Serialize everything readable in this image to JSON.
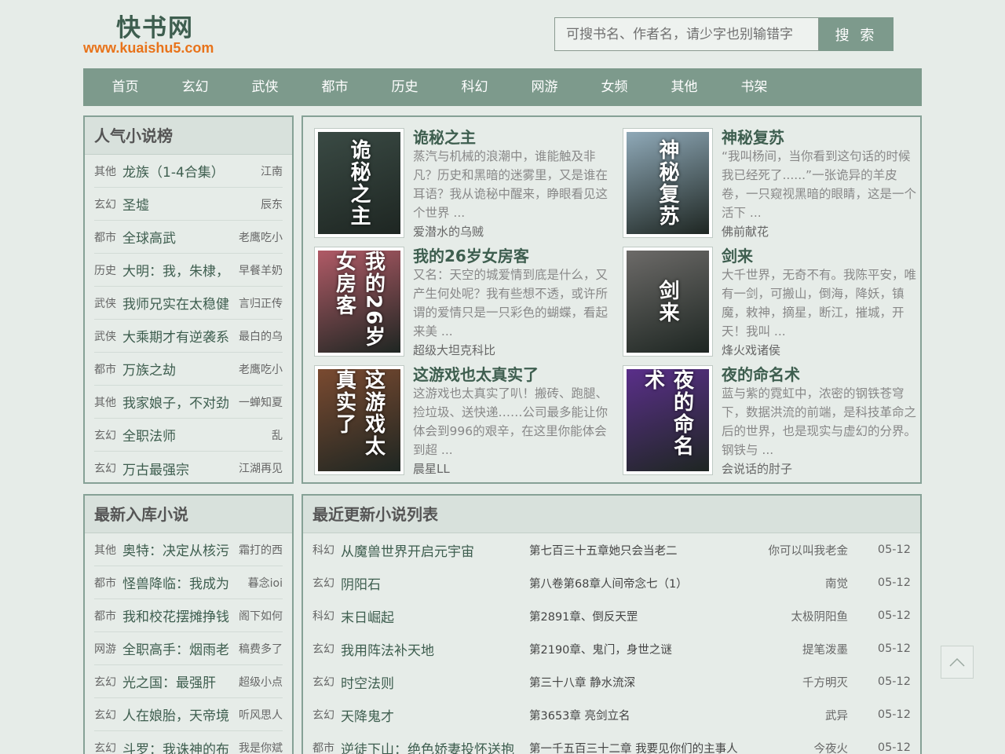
{
  "site": {
    "title": "快书网",
    "url": "www.kuaishu5.com"
  },
  "search": {
    "placeholder": "可搜书名、作者名，请少字也别输错字",
    "button": "搜 索"
  },
  "nav": [
    "首页",
    "玄幻",
    "武侠",
    "都市",
    "历史",
    "科幻",
    "网游",
    "女频",
    "其他",
    "书架"
  ],
  "popular": {
    "title": "人气小说榜",
    "items": [
      {
        "cat": "其他",
        "name": "龙族（1-4合集）",
        "author": "江南"
      },
      {
        "cat": "玄幻",
        "name": "圣墟",
        "author": "辰东"
      },
      {
        "cat": "都市",
        "name": "全球高武",
        "author": "老鹰吃小"
      },
      {
        "cat": "历史",
        "name": "大明：我，朱棣，",
        "author": "早餐羊奶"
      },
      {
        "cat": "武侠",
        "name": "我师兄实在太稳健",
        "author": "言归正传"
      },
      {
        "cat": "武侠",
        "name": "大乘期才有逆袭系",
        "author": "最白的乌"
      },
      {
        "cat": "都市",
        "name": "万族之劫",
        "author": "老鹰吃小"
      },
      {
        "cat": "其他",
        "name": "我家娘子，不对劲",
        "author": "一蝉知夏"
      },
      {
        "cat": "玄幻",
        "name": "全职法师",
        "author": "乱"
      },
      {
        "cat": "玄幻",
        "name": "万古最强宗",
        "author": "江湖再见"
      }
    ]
  },
  "featured": [
    {
      "title": "诡秘之主",
      "desc": "蒸汽与机械的浪潮中，谁能触及非凡？历史和黑暗的迷雾里，又是谁在耳语？我从诡秘中醒来，睁眼看见这个世界 ...",
      "author": "爱潜水的乌贼",
      "cover": "诡秘之主",
      "color": "#3a4a44"
    },
    {
      "title": "神秘复苏",
      "desc": "“我叫杨间，当你看到这句话的时候我已经死了......”一张诡异的羊皮卷，一只窥视黑暗的眼睛，这是一个活下 ...",
      "author": "佛前献花",
      "cover": "神秘复苏",
      "color": "#8fa9b8"
    },
    {
      "title": "我的26岁女房客",
      "desc": "又名：天空的城爱情到底是什么，又产生何处呢？我有些想不透，或许所谓的爱情只是一只彩色的蝴蝶，看起来美 ...",
      "author": "超级大坦克科比",
      "cover": "我的26岁女房客",
      "color": "#b05a66"
    },
    {
      "title": "剑来",
      "desc": "大千世界，无奇不有。我陈平安，唯有一剑，可搬山，倒海，降妖，镇魔，敕神，摘星，断江，摧城，开天！我叫 ...",
      "author": "烽火戏诸侯",
      "cover": "剑来",
      "color": "#6c6a68"
    },
    {
      "title": "这游戏也太真实了",
      "desc": "这游戏也太真实了叭！搬砖、跑腿、捡垃圾、送快递……公司最多能让你体会到996的艰辛，在这里你能体会到超 ...",
      "author": "晨星LL",
      "cover": "这游戏太真实了",
      "color": "#7a4a30"
    },
    {
      "title": "夜的命名术",
      "desc": "蓝与紫的霓虹中，浓密的钢铁苍穹下，数据洪流的前端，是科技革命之后的世界，也是现实与虚幻的分界。钢铁与 ...",
      "author": "会说话的肘子",
      "cover": "夜的命名术",
      "color": "#5a2f8a"
    }
  ],
  "latest": {
    "title": "最新入库小说",
    "items": [
      {
        "cat": "其他",
        "name": "奥特：决定从核污",
        "author": "霜打的西"
      },
      {
        "cat": "都市",
        "name": "怪兽降临：我成为",
        "author": "暮念ioi"
      },
      {
        "cat": "都市",
        "name": "我和校花摆摊挣钱",
        "author": "阁下如何"
      },
      {
        "cat": "网游",
        "name": "全职高手：烟雨老",
        "author": "稿费多了"
      },
      {
        "cat": "玄幻",
        "name": "光之国：最强肝",
        "author": "超级小点"
      },
      {
        "cat": "玄幻",
        "name": "人在娘胎，天帝境",
        "author": "听风思人"
      },
      {
        "cat": "玄幻",
        "name": "斗罗：我诛神的布",
        "author": "我是你斌"
      }
    ]
  },
  "updates": {
    "title": "最近更新小说列表",
    "items": [
      {
        "cat": "科幻",
        "name": "从魔兽世界开启元宇宙",
        "chapter": "第七百三十五章她只会当老二",
        "author": "你可以叫我老金",
        "date": "05-12"
      },
      {
        "cat": "玄幻",
        "name": "阴阳石",
        "chapter": "第八卷第68章人间帝念七（1）",
        "author": "南觉",
        "date": "05-12"
      },
      {
        "cat": "科幻",
        "name": "末日崛起",
        "chapter": "第2891章、倒反天罡",
        "author": "太极阴阳鱼",
        "date": "05-12"
      },
      {
        "cat": "玄幻",
        "name": "我用阵法补天地",
        "chapter": "第2190章、鬼门，身世之谜",
        "author": "提笔泼墨",
        "date": "05-12"
      },
      {
        "cat": "玄幻",
        "name": "时空法则",
        "chapter": "第三十八章 静水流深",
        "author": "千方明灭",
        "date": "05-12"
      },
      {
        "cat": "玄幻",
        "name": "天降鬼才",
        "chapter": "第3653章 亮剑立名",
        "author": "武异",
        "date": "05-12"
      },
      {
        "cat": "都市",
        "name": "逆徒下山：绝色娇妻投怀送抱",
        "chapter": "第一千五百三十二章 我要见你们的主事人",
        "author": "今夜火",
        "date": "05-12"
      }
    ]
  }
}
